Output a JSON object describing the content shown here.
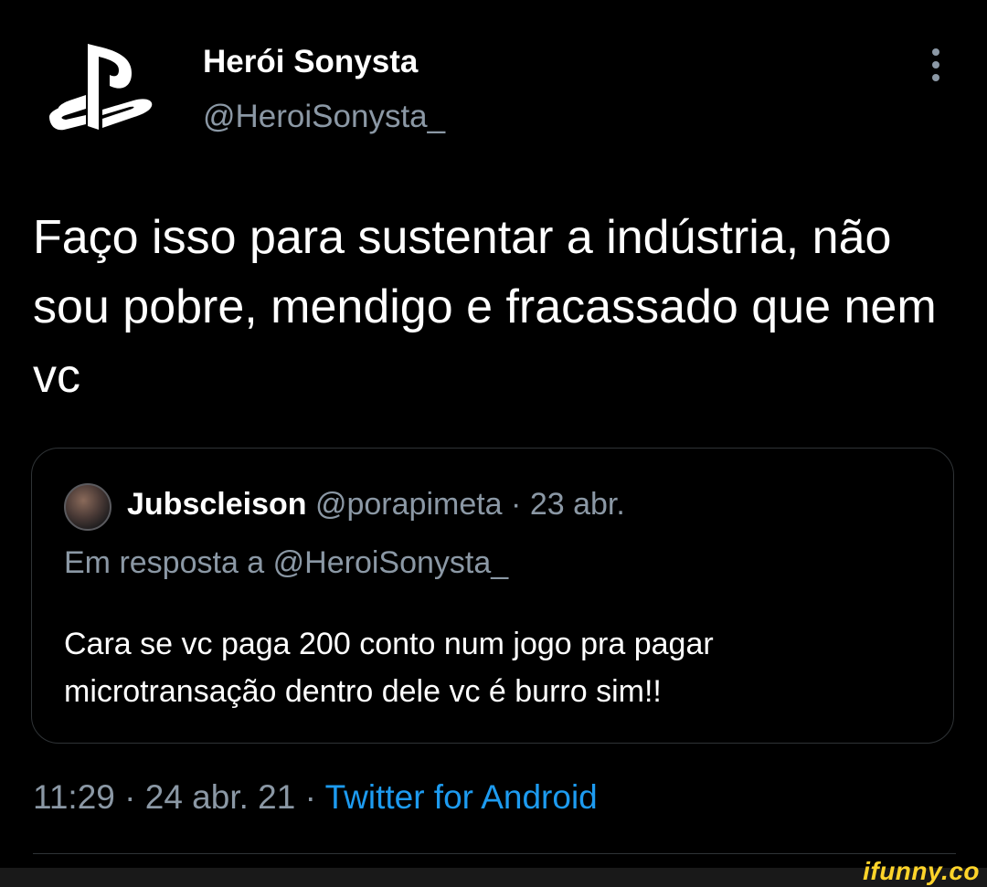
{
  "author": {
    "display_name": "Herói Sonysta",
    "handle": "@HeroiSonysta_",
    "avatar_icon": "playstation-logo-icon"
  },
  "tweet": {
    "text": "Faço isso para sustentar a indústria, não sou pobre, mendigo e fracassado que nem vc",
    "time": "11:29",
    "date": "24 abr. 21",
    "separator": " · ",
    "source": "Twitter for Android"
  },
  "quoted_tweet": {
    "display_name": "Jubscleison",
    "handle": "@porapimeta",
    "separator": " · ",
    "date": "23 abr.",
    "reply_to": "Em resposta a @HeroiSonysta_",
    "text": "Cara se vc paga 200 conto num jogo pra pagar microtransação dentro dele vc é burro sim!!"
  },
  "watermark": {
    "text": "ifunny.co"
  },
  "colors": {
    "background": "#000000",
    "secondary_text": "#8b98a5",
    "link": "#1d9bf0",
    "border": "#2f3336",
    "watermark": "#ffd42a"
  }
}
